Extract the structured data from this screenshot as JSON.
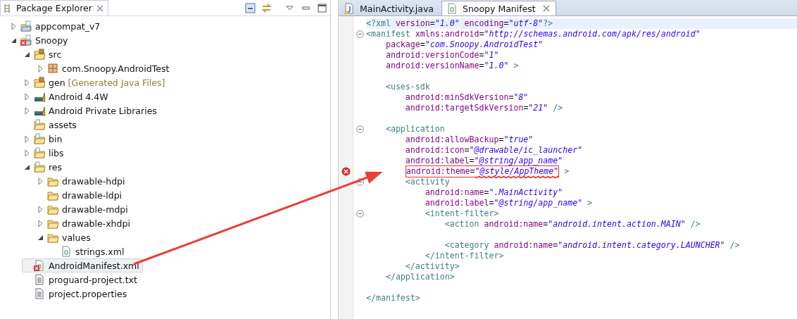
{
  "explorer": {
    "tab": {
      "label": "Package Explorer"
    },
    "tree": [
      {
        "label": "appcompat_v7",
        "kind": "project",
        "expanded": false,
        "error": false,
        "selected": false
      },
      {
        "label": "Snoopy",
        "kind": "project",
        "expanded": true,
        "error": true,
        "selected": false,
        "children": [
          {
            "label": "src",
            "kind": "source-folder",
            "expanded": true,
            "error": false,
            "selected": false,
            "children": [
              {
                "label": "com.Snoopy.AndroidTest",
                "kind": "package",
                "expanded": false,
                "error": false,
                "selected": false
              }
            ]
          },
          {
            "label": "gen",
            "decoration": "[Generated Java Files]",
            "kind": "source-folder",
            "expanded": false,
            "error": false,
            "selected": false
          },
          {
            "label": "Android 4.4W",
            "kind": "library",
            "expanded": false,
            "error": false,
            "selected": false
          },
          {
            "label": "Android Private Libraries",
            "kind": "library",
            "expanded": false,
            "error": false,
            "selected": false
          },
          {
            "label": "assets",
            "kind": "resource-folder",
            "error": false,
            "selected": false
          },
          {
            "label": "bin",
            "kind": "resource-folder",
            "expanded": false,
            "error": false,
            "selected": false
          },
          {
            "label": "libs",
            "kind": "resource-folder",
            "expanded": false,
            "error": false,
            "selected": false
          },
          {
            "label": "res",
            "kind": "resource-folder",
            "expanded": true,
            "error": false,
            "selected": false,
            "children": [
              {
                "label": "drawable-hdpi",
                "kind": "folder",
                "expanded": false,
                "error": false,
                "selected": false
              },
              {
                "label": "drawable-ldpi",
                "kind": "folder",
                "error": false,
                "selected": false
              },
              {
                "label": "drawable-mdpi",
                "kind": "folder",
                "expanded": false,
                "error": false,
                "selected": false
              },
              {
                "label": "drawable-xhdpi",
                "kind": "folder",
                "expanded": false,
                "error": false,
                "selected": false
              },
              {
                "label": "values",
                "kind": "folder",
                "expanded": true,
                "error": false,
                "selected": false,
                "children": [
                  {
                    "label": "strings.xml",
                    "kind": "xml-file",
                    "error": false,
                    "selected": false
                  }
                ]
              }
            ]
          },
          {
            "label": "AndroidManifest.xml",
            "kind": "xml-file",
            "error": true,
            "selected": true
          },
          {
            "label": "proguard-project.txt",
            "kind": "text-file",
            "error": false,
            "selected": false
          },
          {
            "label": "project.properties",
            "kind": "text-file",
            "error": false,
            "selected": false
          }
        ]
      }
    ]
  },
  "editor": {
    "tabs": [
      {
        "label": "MainActivity.java",
        "kind": "java-file",
        "selected": false
      },
      {
        "label": "Snoopy Manifest",
        "kind": "xml-file",
        "selected": true
      }
    ],
    "lines": [
      {
        "kind": "code",
        "current": true,
        "foldable": false,
        "error": false,
        "tokens": [
          {
            "kind": "tag",
            "text": "<?xml"
          },
          {
            "kind": "attr",
            "text": " version"
          },
          {
            "kind": "punct",
            "text": "="
          },
          {
            "kind": "value",
            "text": "\"1.0\""
          },
          {
            "kind": "attr",
            "text": " encoding"
          },
          {
            "kind": "punct",
            "text": "="
          },
          {
            "kind": "value",
            "text": "\"utf-8\""
          },
          {
            "kind": "tag",
            "text": "?>"
          }
        ]
      },
      {
        "kind": "code",
        "current": false,
        "foldable": true,
        "error": false,
        "tokens": [
          {
            "kind": "tag",
            "text": "<manifest"
          },
          {
            "kind": "attr",
            "text": " xmlns:android"
          },
          {
            "kind": "punct",
            "text": "="
          },
          {
            "kind": "value",
            "text": "\"http://schemas.android.com/apk/res/android\""
          }
        ]
      },
      {
        "kind": "code",
        "current": false,
        "foldable": false,
        "error": false,
        "tokens": [
          {
            "kind": "attr",
            "text": "    package"
          },
          {
            "kind": "punct",
            "text": "="
          },
          {
            "kind": "value",
            "text": "\"com.Snoopy.AndroidTest\""
          }
        ]
      },
      {
        "kind": "code",
        "current": false,
        "foldable": false,
        "error": false,
        "tokens": [
          {
            "kind": "attr",
            "text": "    android:versionCode"
          },
          {
            "kind": "punct",
            "text": "="
          },
          {
            "kind": "value",
            "text": "\"1\""
          }
        ]
      },
      {
        "kind": "code",
        "current": false,
        "foldable": false,
        "error": false,
        "tokens": [
          {
            "kind": "attr",
            "text": "    android:versionName"
          },
          {
            "kind": "punct",
            "text": "="
          },
          {
            "kind": "value",
            "text": "\"1.0\""
          },
          {
            "kind": "tag",
            "text": " >"
          }
        ]
      },
      {
        "kind": "blank"
      },
      {
        "kind": "code",
        "current": false,
        "foldable": false,
        "error": false,
        "tokens": [
          {
            "kind": "tag",
            "text": "    <uses-sdk"
          }
        ]
      },
      {
        "kind": "code",
        "current": false,
        "foldable": false,
        "error": false,
        "tokens": [
          {
            "kind": "attr",
            "text": "        android:minSdkVersion"
          },
          {
            "kind": "punct",
            "text": "="
          },
          {
            "kind": "value",
            "text": "\"8\""
          }
        ]
      },
      {
        "kind": "code",
        "current": false,
        "foldable": false,
        "error": false,
        "tokens": [
          {
            "kind": "attr",
            "text": "        android:targetSdkVersion"
          },
          {
            "kind": "punct",
            "text": "="
          },
          {
            "kind": "value",
            "text": "\"21\""
          },
          {
            "kind": "tag",
            "text": " />"
          }
        ]
      },
      {
        "kind": "blank"
      },
      {
        "kind": "code",
        "current": false,
        "foldable": true,
        "error": false,
        "tokens": [
          {
            "kind": "tag",
            "text": "    <application"
          }
        ]
      },
      {
        "kind": "code",
        "current": false,
        "foldable": false,
        "error": false,
        "tokens": [
          {
            "kind": "attr",
            "text": "        android:allowBackup"
          },
          {
            "kind": "punct",
            "text": "="
          },
          {
            "kind": "value",
            "text": "\"true\""
          }
        ]
      },
      {
        "kind": "code",
        "current": false,
        "foldable": false,
        "error": false,
        "tokens": [
          {
            "kind": "attr",
            "text": "        android:icon"
          },
          {
            "kind": "punct",
            "text": "="
          },
          {
            "kind": "value",
            "text": "\"@drawable/ic_launcher\""
          }
        ]
      },
      {
        "kind": "code",
        "current": false,
        "foldable": false,
        "error": false,
        "tokens": [
          {
            "kind": "attr",
            "text": "        android:label"
          },
          {
            "kind": "punct",
            "text": "="
          },
          {
            "kind": "value",
            "text": "\"@string/app_name\""
          }
        ]
      },
      {
        "kind": "code",
        "current": false,
        "foldable": false,
        "error": true,
        "tokens": [
          {
            "kind": "annotation",
            "tokens": [
              {
                "kind": "attr",
                "text": "        android:theme"
              },
              {
                "kind": "punct",
                "text": "="
              },
              {
                "kind": "value-error",
                "text": "\"@style/AppTheme\""
              }
            ]
          },
          {
            "kind": "tag",
            "text": " >"
          }
        ]
      },
      {
        "kind": "code",
        "current": false,
        "foldable": true,
        "error": false,
        "tokens": [
          {
            "kind": "tag",
            "text": "        <activity"
          }
        ]
      },
      {
        "kind": "code",
        "current": false,
        "foldable": false,
        "error": false,
        "tokens": [
          {
            "kind": "attr",
            "text": "            android:name"
          },
          {
            "kind": "punct",
            "text": "="
          },
          {
            "kind": "value",
            "text": "\".MainActivity\""
          }
        ]
      },
      {
        "kind": "code",
        "current": false,
        "foldable": false,
        "error": false,
        "tokens": [
          {
            "kind": "attr",
            "text": "            android:label"
          },
          {
            "kind": "punct",
            "text": "="
          },
          {
            "kind": "value",
            "text": "\"@string/app_name\""
          },
          {
            "kind": "tag",
            "text": " >"
          }
        ]
      },
      {
        "kind": "code",
        "current": false,
        "foldable": true,
        "error": false,
        "tokens": [
          {
            "kind": "tag",
            "text": "            <intent-filter>"
          }
        ]
      },
      {
        "kind": "code",
        "current": false,
        "foldable": false,
        "error": false,
        "tokens": [
          {
            "kind": "tag",
            "text": "                <action"
          },
          {
            "kind": "attr",
            "text": " android:name"
          },
          {
            "kind": "punct",
            "text": "="
          },
          {
            "kind": "value",
            "text": "\"android.intent.action.MAIN\""
          },
          {
            "kind": "tag",
            "text": " />"
          }
        ]
      },
      {
        "kind": "blank"
      },
      {
        "kind": "code",
        "current": false,
        "foldable": false,
        "error": false,
        "tokens": [
          {
            "kind": "tag",
            "text": "                <category"
          },
          {
            "kind": "attr",
            "text": " android:name"
          },
          {
            "kind": "punct",
            "text": "="
          },
          {
            "kind": "value",
            "text": "\"android.intent.category.LAUNCHER\""
          },
          {
            "kind": "tag",
            "text": " />"
          }
        ]
      },
      {
        "kind": "code",
        "current": false,
        "foldable": false,
        "error": false,
        "tokens": [
          {
            "kind": "tag",
            "text": "            </intent-filter>"
          }
        ]
      },
      {
        "kind": "code",
        "current": false,
        "foldable": false,
        "error": false,
        "tokens": [
          {
            "kind": "tag",
            "text": "        </activity>"
          }
        ]
      },
      {
        "kind": "code",
        "current": false,
        "foldable": false,
        "error": false,
        "tokens": [
          {
            "kind": "tag",
            "text": "    </application>"
          }
        ]
      },
      {
        "kind": "blank"
      },
      {
        "kind": "code",
        "current": false,
        "foldable": false,
        "error": false,
        "tokens": [
          {
            "kind": "tag",
            "text": "</manifest>"
          }
        ]
      }
    ]
  }
}
